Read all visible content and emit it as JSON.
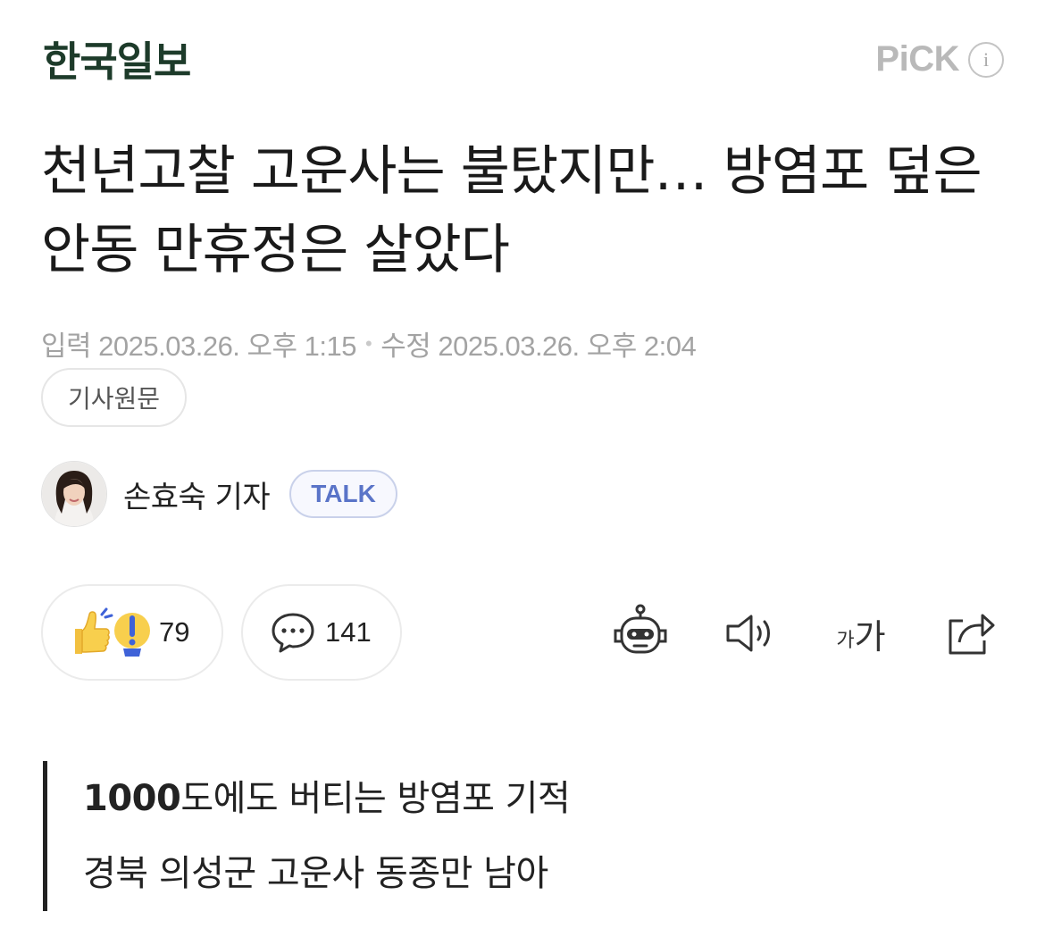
{
  "press": {
    "name": "한국일보"
  },
  "pick": {
    "label": "PiCK",
    "info_glyph": "i"
  },
  "article": {
    "headline": "천년고찰 고운사는 불탔지만… 방염포 덮은 안동 만휴정은 살았다",
    "published": "입력 2025.03.26. 오후 1:15",
    "separator": "•",
    "modified": "수정 2025.03.26. 오후 2:04",
    "original_button": "기사원문"
  },
  "reporter": {
    "name": "손효숙 기자",
    "talk_label": "TALK"
  },
  "reactions": {
    "like_count": "79",
    "comment_count": "141"
  },
  "toolbar": {
    "bot_icon": "robot-icon",
    "speaker_icon": "speaker-icon",
    "font_size_small": "가",
    "font_size_large": "가",
    "share_icon": "share-icon"
  },
  "subheading": {
    "line1_bold": "1000",
    "line1_rest": "도에도 버티는 방염포 기적",
    "line2": "경북 의성군 고운사 동종만 남아"
  },
  "colors": {
    "press_logo": "#1d3b2a",
    "talk_accent": "#5a74c8",
    "muted_text": "#a3a3a3"
  }
}
